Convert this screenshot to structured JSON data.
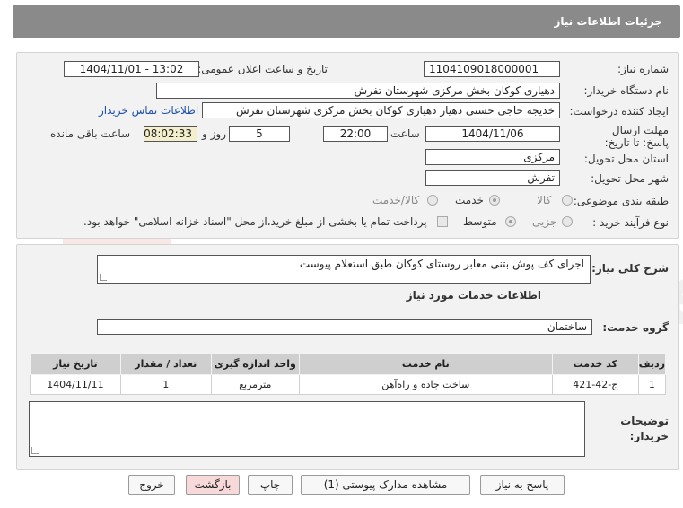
{
  "header": {
    "title": "جزئیات اطلاعات نیاز"
  },
  "form": {
    "need_number_label": "شماره نیاز:",
    "need_number": "1104109018000001",
    "announce_label": "تاریخ و ساعت اعلان عمومی:",
    "announce_value": "1404/11/01 - 13:02",
    "buyer_org_label": "نام دستگاه خریدار:",
    "buyer_org": "دهیاری کوکان بخش مرکزی شهرستان تفرش",
    "creator_label": "ایجاد کننده درخواست:",
    "creator": "خدیجه حاجی حسنی دهیار دهیاری کوکان بخش مرکزی شهرستان تفرش",
    "contact_link": "اطلاعات تماس خریدار",
    "deadline_label": "مهلت ارسال پاسخ: تا تاریخ:",
    "deadline_date": "1404/11/06",
    "time_label": "ساعت",
    "deadline_time": "22:00",
    "days_value": "5",
    "days_label": "روز و",
    "remaining_time": "08:02:33",
    "remaining_label": "ساعت باقی مانده",
    "province_label": "استان محل تحویل:",
    "province": "مرکزی",
    "city_label": "شهر محل تحویل:",
    "city": "تفرش",
    "category_label": "طبقه بندی موضوعی:",
    "category_options": [
      "کالا",
      "خدمت",
      "کالا/خدمت"
    ],
    "purchase_type_label": "نوع فرآیند خرید :",
    "purchase_options": [
      "جزیی",
      "متوسط"
    ],
    "payment_note": "پرداخت تمام یا بخشی از مبلغ خرید،از محل \"اسناد خزانه اسلامی\" خواهد بود."
  },
  "details": {
    "summary_label": "شرح کلی نیاز:",
    "summary": "اجرای کف پوش بتنی معابر روستای کوکان طبق استعلام پیوست",
    "services_title": "اطلاعات خدمات مورد نیاز",
    "service_group_label": "گروه خدمت:",
    "service_group": "ساختمان",
    "table": {
      "headers": [
        "ردیف",
        "کد خدمت",
        "نام خدمت",
        "واحد اندازه گیری",
        "تعداد / مقدار",
        "تاریخ نیاز"
      ],
      "rows": [
        [
          "1",
          "ج-42-421",
          "ساخت جاده و راه‌آهن",
          "مترمربع",
          "1",
          "1404/11/11"
        ]
      ]
    },
    "buyer_notes_label_1": "توضیحات",
    "buyer_notes_label_2": "خریدار:"
  },
  "buttons": {
    "reply": "پاسخ به نیاز",
    "attachments": "مشاهده مدارک پیوستی (1)",
    "print": "چاپ",
    "back": "بازگشت",
    "exit": "خروج"
  },
  "colors": {
    "header_bg": "#8a8a8a",
    "panel_bg": "#f2f2f2",
    "link": "#1a4fa8",
    "remaining_bg": "#f3efcc",
    "pink_button": "#f7d9d9"
  }
}
